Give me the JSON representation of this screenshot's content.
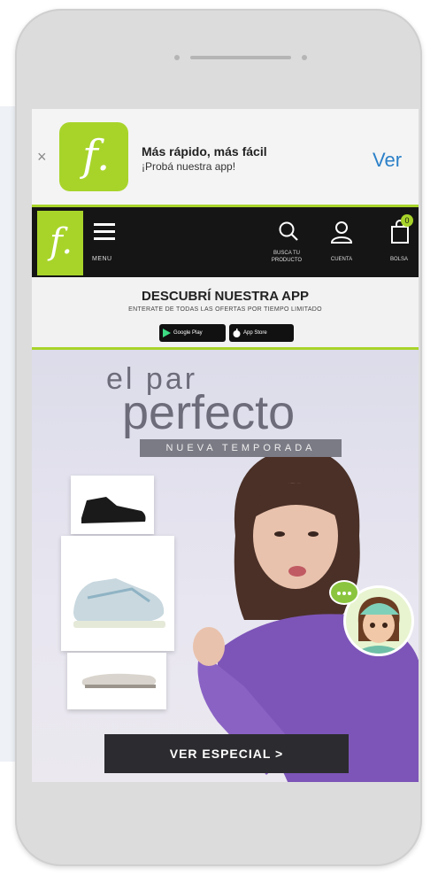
{
  "app_banner": {
    "close": "×",
    "title": "Más rápido, más fácil",
    "subtitle": "¡Probá nuestra app!",
    "cta": "Ver"
  },
  "brand": {
    "logo_letter": "f.",
    "accent_color": "#a8d42a"
  },
  "header": {
    "menu_label": "MENU",
    "search_label": "BUSCA TU PRODUCTO",
    "account_label": "CUENTA",
    "bag_label": "BOLSA",
    "bag_count": "0",
    "icons": [
      "menu-icon",
      "search-icon",
      "user-icon",
      "bag-icon"
    ]
  },
  "promo": {
    "title": "DESCUBRÍ NUESTRA APP",
    "subtitle": "ENTERATE DE TODAS LAS OFERTAS POR TIEMPO LIMITADO",
    "google_play": "Google Play",
    "app_store": "App Store"
  },
  "hero": {
    "line1": "el par",
    "line2": "perfecto",
    "tag": "NUEVA TEMPORADA",
    "cta": "VER ESPECIAL >"
  },
  "device": {
    "frame_color": "#dcdcdc"
  }
}
